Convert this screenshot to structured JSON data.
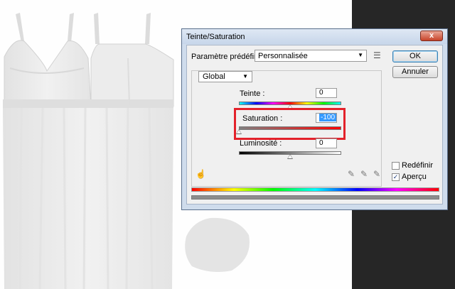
{
  "dialog": {
    "title": "Teinte/Saturation",
    "close_label": "x",
    "preset": {
      "label": "Paramètre prédéfini :",
      "value": "Personnalisée",
      "menu_icon": "preset-options-icon"
    },
    "buttons": {
      "ok": "OK",
      "cancel": "Annuler"
    },
    "channel": {
      "value": "Global"
    },
    "hue": {
      "label": "Teinte :",
      "value": "0",
      "level": 0.5
    },
    "saturation": {
      "label": "Saturation :",
      "value": "-100",
      "level": 0.0
    },
    "lightness": {
      "label": "Luminosité :",
      "value": "0",
      "level": 0.5
    },
    "colorize": {
      "label": "Redéfinir",
      "checked": false
    },
    "preview": {
      "label": "Aperçu",
      "checked": true
    },
    "icons": [
      "hand-adjust-icon",
      "eyedropper-icon",
      "eyedropper-plus-icon",
      "eyedropper-minus-icon"
    ],
    "highlight_color": "#e3222b"
  },
  "canvas": {
    "content": "white dress image",
    "background": "#fefefe",
    "side_panel_color": "#262626"
  }
}
